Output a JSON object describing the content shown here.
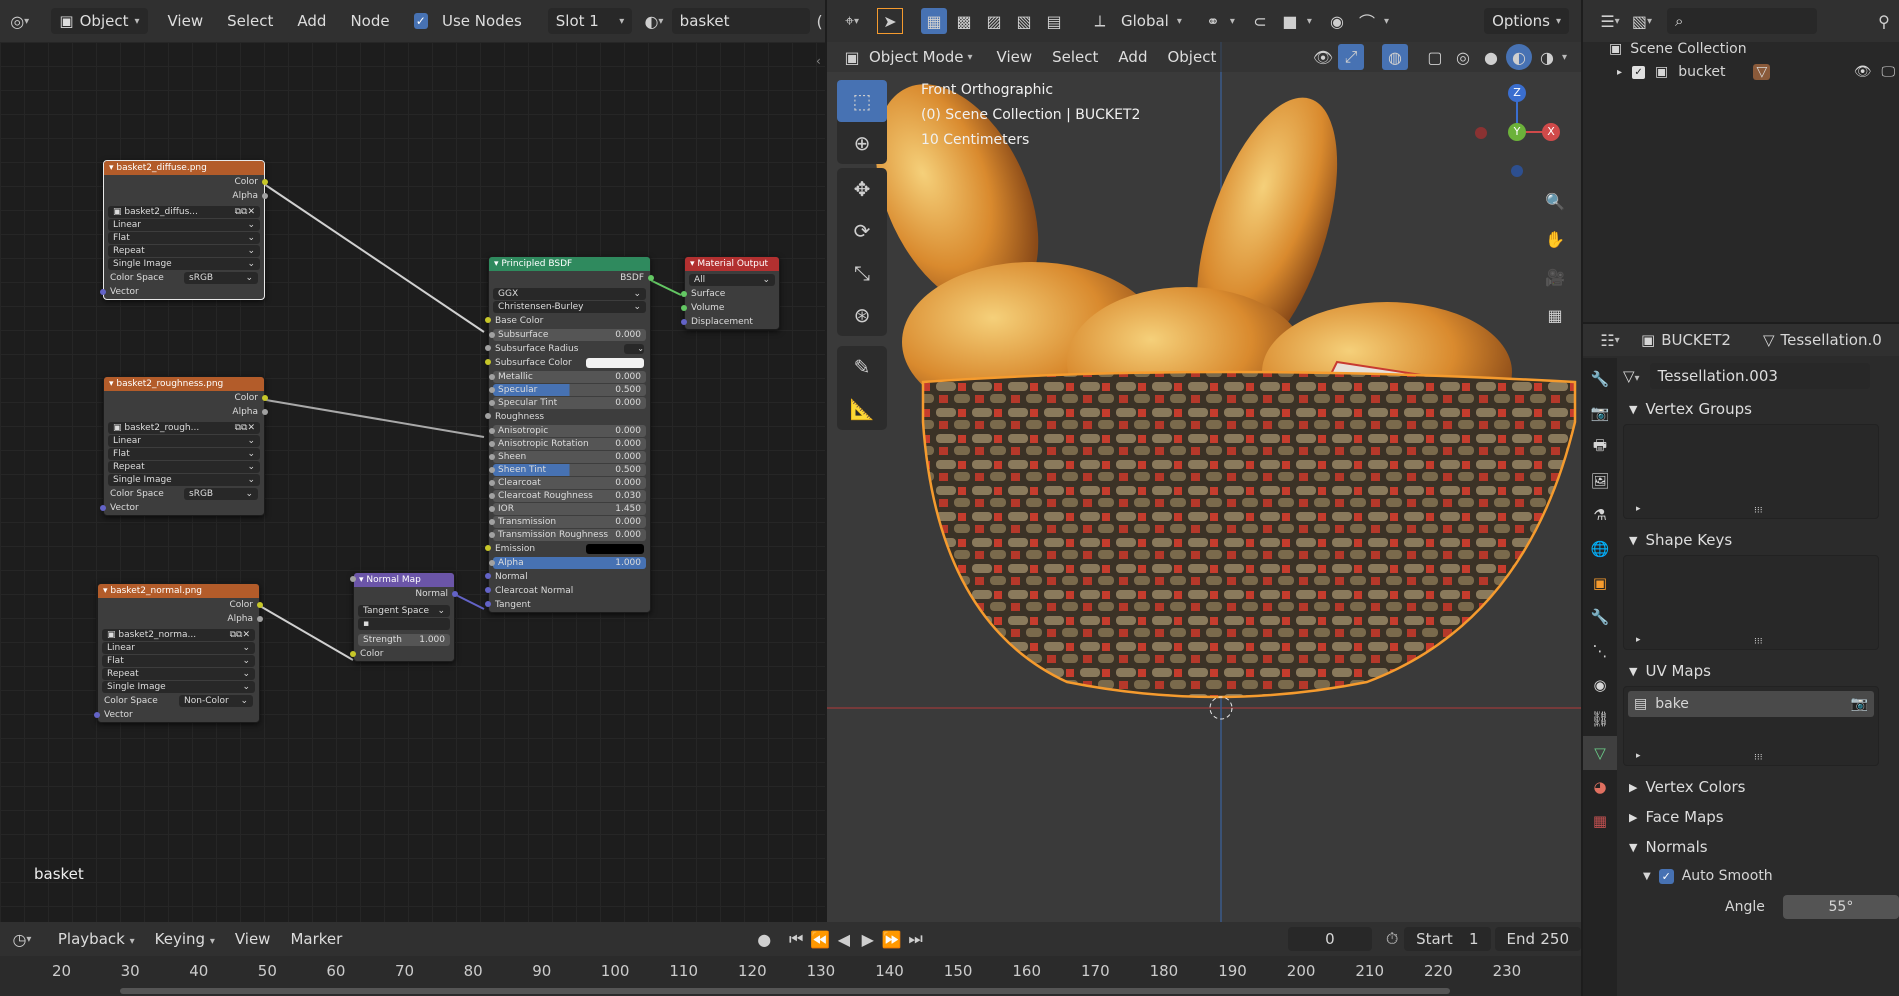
{
  "node_header": {
    "mode": "Object",
    "menus": [
      "View",
      "Select",
      "Add",
      "Node"
    ],
    "use_nodes_label": "Use Nodes",
    "slot": "Slot 1",
    "material": "basket"
  },
  "node_editor": {
    "material_label": "basket",
    "diffuse_node": {
      "title": "basket2_diffuse.png",
      "out_color": "Color",
      "out_alpha": "Alpha",
      "image": "basket2_diffus...",
      "interp": "Linear",
      "proj": "Flat",
      "ext": "Repeat",
      "src": "Single Image",
      "cs_label": "Color Space",
      "cs": "sRGB",
      "vector": "Vector"
    },
    "rough_node": {
      "title": "basket2_roughness.png",
      "out_color": "Color",
      "out_alpha": "Alpha",
      "image": "basket2_rough...",
      "interp": "Linear",
      "proj": "Flat",
      "ext": "Repeat",
      "src": "Single Image",
      "cs_label": "Color Space",
      "cs": "sRGB",
      "vector": "Vector"
    },
    "normal_tex_node": {
      "title": "basket2_normal.png",
      "out_color": "Color",
      "out_alpha": "Alpha",
      "image": "basket2_norma...",
      "interp": "Linear",
      "proj": "Flat",
      "ext": "Repeat",
      "src": "Single Image",
      "cs_label": "Color Space",
      "cs": "Non-Color",
      "vector": "Vector"
    },
    "normal_map_node": {
      "title": "Normal Map",
      "out": "Normal",
      "space": "Tangent Space",
      "strength_label": "Strength",
      "strength": "1.000",
      "color": "Color"
    },
    "bsdf_node": {
      "title": "Principled BSDF",
      "out": "BSDF",
      "dist": "GGX",
      "sss": "Christensen-Burley",
      "rows": [
        {
          "label": "Base Color",
          "type": "sock"
        },
        {
          "label": "Subsurface",
          "value": "0.000",
          "type": "field"
        },
        {
          "label": "Subsurface Radius",
          "type": "drop"
        },
        {
          "label": "Subsurface Color",
          "type": "color"
        },
        {
          "label": "Metallic",
          "value": "0.000",
          "type": "field"
        },
        {
          "label": "Specular",
          "value": "0.500",
          "type": "bar",
          "fill": 0.5
        },
        {
          "label": "Specular Tint",
          "value": "0.000",
          "type": "field"
        },
        {
          "label": "Roughness",
          "type": "sock"
        },
        {
          "label": "Anisotropic",
          "value": "0.000",
          "type": "field"
        },
        {
          "label": "Anisotropic Rotation",
          "value": "0.000",
          "type": "field"
        },
        {
          "label": "Sheen",
          "value": "0.000",
          "type": "field"
        },
        {
          "label": "Sheen Tint",
          "value": "0.500",
          "type": "bar",
          "fill": 0.5
        },
        {
          "label": "Clearcoat",
          "value": "0.000",
          "type": "field"
        },
        {
          "label": "Clearcoat Roughness",
          "value": "0.030",
          "type": "field"
        },
        {
          "label": "IOR",
          "value": "1.450",
          "type": "field"
        },
        {
          "label": "Transmission",
          "value": "0.000",
          "type": "field"
        },
        {
          "label": "Transmission Roughness",
          "value": "0.000",
          "type": "field"
        },
        {
          "label": "Emission",
          "type": "black"
        },
        {
          "label": "Alpha",
          "value": "1.000",
          "type": "bar",
          "fill": 1.0
        },
        {
          "label": "Normal",
          "type": "sock"
        },
        {
          "label": "Clearcoat Normal",
          "type": "sock"
        },
        {
          "label": "Tangent",
          "type": "sock"
        }
      ]
    },
    "output_node": {
      "title": "Material Output",
      "target": "All",
      "surface": "Surface",
      "volume": "Volume",
      "displacement": "Displacement"
    }
  },
  "viewport": {
    "header": {
      "transform": "Global",
      "options": "Options",
      "mode": "Object Mode",
      "menus": [
        "View",
        "Select",
        "Add",
        "Object"
      ]
    },
    "overlay": {
      "view": "Front Orthographic",
      "collection": "(0) Scene Collection | BUCKET2",
      "scale": "10 Centimeters"
    },
    "gizmo": {
      "z": "Z",
      "y": "Y",
      "x": "X"
    }
  },
  "outliner": {
    "scene_collection": "Scene Collection",
    "item": "bucket"
  },
  "properties": {
    "object": "BUCKET2",
    "modifier": "Tessellation.0",
    "mesh": "Tessellation.003",
    "sections": {
      "vertex_groups": "Vertex Groups",
      "shape_keys": "Shape Keys",
      "uv_maps": "UV Maps",
      "vertex_colors": "Vertex Colors",
      "face_maps": "Face Maps",
      "normals": "Normals"
    },
    "uv_map": "bake",
    "auto_smooth": "Auto Smooth",
    "angle_label": "Angle",
    "angle": "55°"
  },
  "timeline": {
    "menus": [
      "Playback",
      "Keying",
      "View",
      "Marker"
    ],
    "current": "0",
    "start_label": "Start",
    "start": "1",
    "end_label": "End",
    "end": "250",
    "ticks": [
      "20",
      "30",
      "40",
      "50",
      "60",
      "70",
      "80",
      "90",
      "100",
      "110",
      "120",
      "130",
      "140",
      "150",
      "160",
      "170",
      "180",
      "190",
      "200",
      "210",
      "220",
      "230"
    ]
  },
  "colors": {
    "accent": "#4772b3",
    "selection": "#f59b2e",
    "texture_header": "#b35c2a",
    "bsdf_header": "#2f8a5e",
    "output_header": "#b23030",
    "normalmap_header": "#6b55a8"
  }
}
